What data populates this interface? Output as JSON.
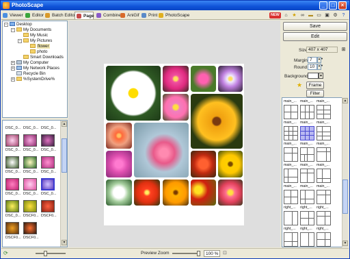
{
  "window": {
    "title": "PhotoScape"
  },
  "tabs": [
    {
      "label": "Viewer",
      "color": "#4a8fe0"
    },
    {
      "label": "Editor",
      "color": "#3aa63a"
    },
    {
      "label": "Batch Editor",
      "color": "#d99a2a"
    },
    {
      "label": "Page",
      "color": "#c84a4a"
    },
    {
      "label": "Combine",
      "color": "#8a5ac8"
    },
    {
      "label": "AniGif",
      "color": "#d86a2a"
    },
    {
      "label": "Print",
      "color": "#5a8ac8"
    },
    {
      "label": "PhotoScape",
      "color": "#e0b020"
    }
  ],
  "active_tab": 3,
  "top_right_badge": "NEW",
  "tree": {
    "nodes": [
      {
        "label": "Desktop",
        "toggle": "−"
      },
      {
        "label": "My Documents",
        "toggle": "−"
      },
      {
        "label": "My Music",
        "toggle": ""
      },
      {
        "label": "My Pictures",
        "toggle": "−"
      },
      {
        "label": "flower",
        "toggle": ""
      },
      {
        "label": "photo",
        "toggle": ""
      },
      {
        "label": "Smart Downloads",
        "toggle": ""
      },
      {
        "label": "My Computer",
        "toggle": "+"
      },
      {
        "label": "My Network Places",
        "toggle": "+"
      },
      {
        "label": "Recycle Bin",
        "toggle": ""
      },
      {
        "label": "%SystemDrive%",
        "toggle": "+"
      }
    ]
  },
  "thumbnails": {
    "labels": [
      "DSC_0...",
      "DSC_0...",
      "DSC_0...",
      "DSC_0...",
      "DSC_0...",
      "DSC_0...",
      "DSC_0...",
      "DSC_0...",
      "DSC_0...",
      "DSC_0...",
      "DSC_0...",
      "DSC_0...",
      "DSC_0...",
      "DSCF0...",
      "DSCF0...",
      "DSCF0...",
      "DSCF0..."
    ]
  },
  "right_panel": {
    "save_label": "Save",
    "edit_label": "Edit",
    "size_label": "Size",
    "size_value": "407 x 407",
    "margin_label": "Margin",
    "margin_value": "7",
    "round_label": "Round",
    "round_value": "10",
    "background_label": "Background",
    "frame_label": "Frame",
    "filter_label": "Filter",
    "layout_names": [
      "main_...",
      "main_...",
      "main_...",
      "main_...",
      "main_...",
      "main_...",
      "main_...",
      "main_...",
      "main_...",
      "main_...",
      "main_...",
      "main_...",
      "right_...",
      "right_...",
      "right_..."
    ]
  },
  "status": {
    "preview_zoom_label": "Preview Zoom",
    "zoom_value": "100 %"
  },
  "colors": {
    "titlebar": "#0f52d8",
    "layout_selected": "#b9b9f2",
    "canvas_bg": "#dedede"
  }
}
